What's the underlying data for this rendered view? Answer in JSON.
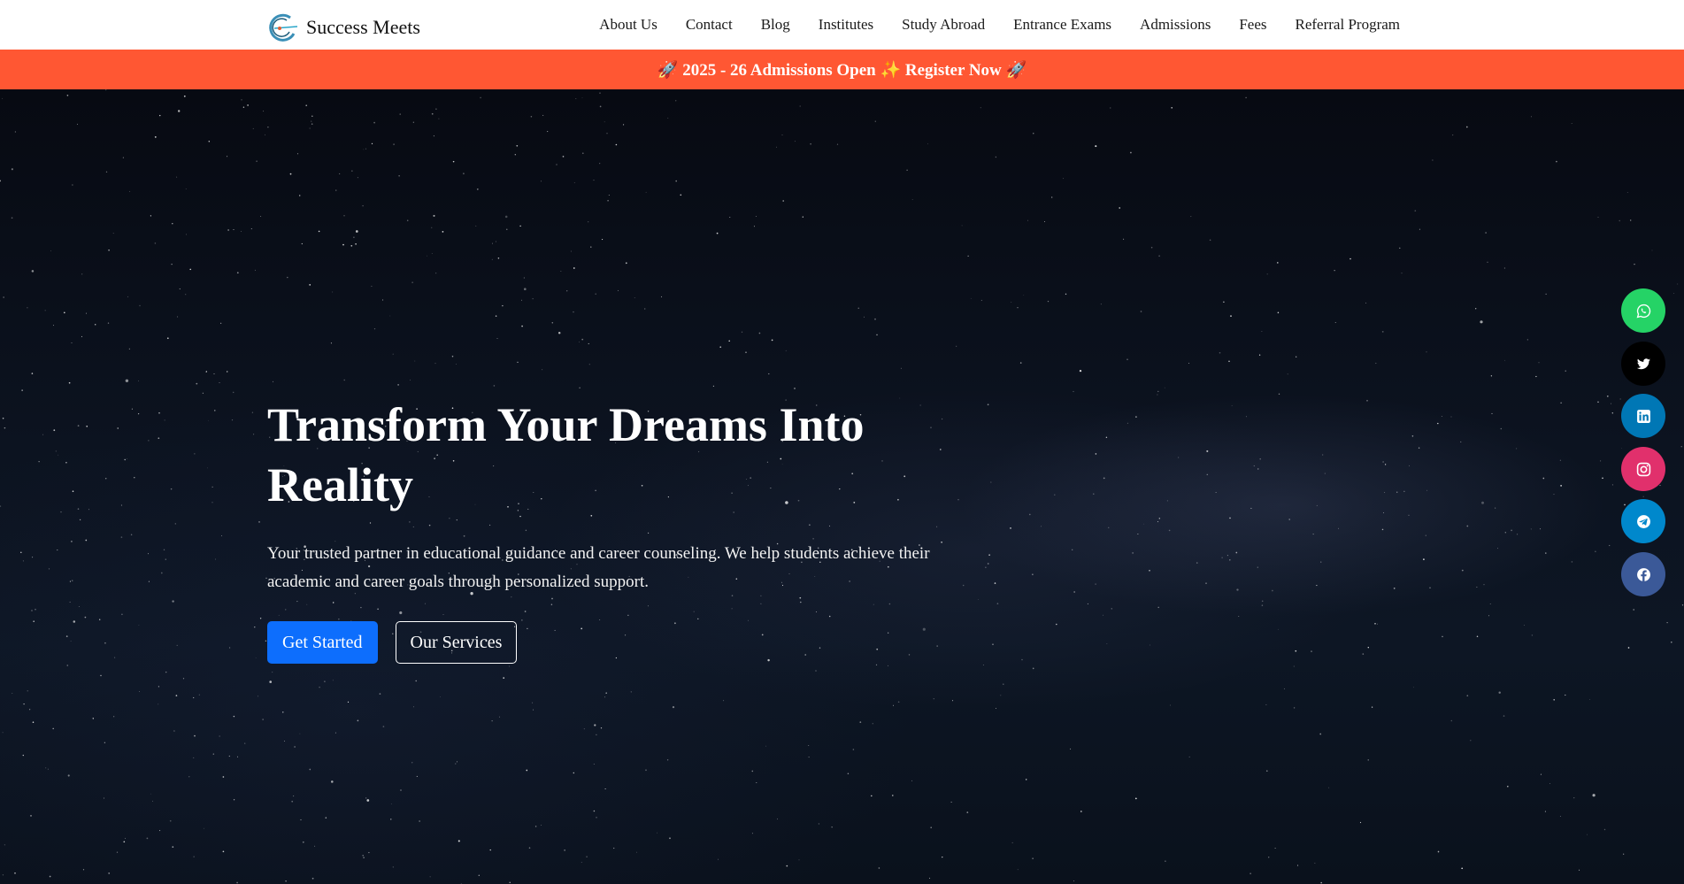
{
  "brand": {
    "name": "Success Meets"
  },
  "nav": {
    "links": [
      "About Us",
      "Contact",
      "Blog",
      "Institutes",
      "Study Abroad",
      "Entrance Exams",
      "Admissions",
      "Fees",
      "Referral Program"
    ]
  },
  "banner": {
    "text": "🚀 2025 - 26 Admissions Open ✨ Register Now 🚀"
  },
  "hero": {
    "title": "Transform Your Dreams Into Reality",
    "subtitle": "Your trusted partner in educational guidance and career counseling. We help students achieve their academic and career goals through personalized support.",
    "primary_button": "Get Started",
    "secondary_button": "Our Services"
  },
  "social": [
    {
      "icon": "whatsapp-icon",
      "color": "#25d366"
    },
    {
      "icon": "twitter-icon",
      "color": "#000000"
    },
    {
      "icon": "linkedin-icon",
      "color": "#0077b5"
    },
    {
      "icon": "instagram-icon",
      "color": "#e1306c"
    },
    {
      "icon": "telegram-icon",
      "color": "#0088cc"
    },
    {
      "icon": "facebook-icon",
      "color": "#3b5998"
    }
  ],
  "colors": {
    "banner": "#ff5733",
    "primary": "#0d6efd",
    "nav_bg": "#ffffff",
    "hero_bg": "#0b1220"
  }
}
